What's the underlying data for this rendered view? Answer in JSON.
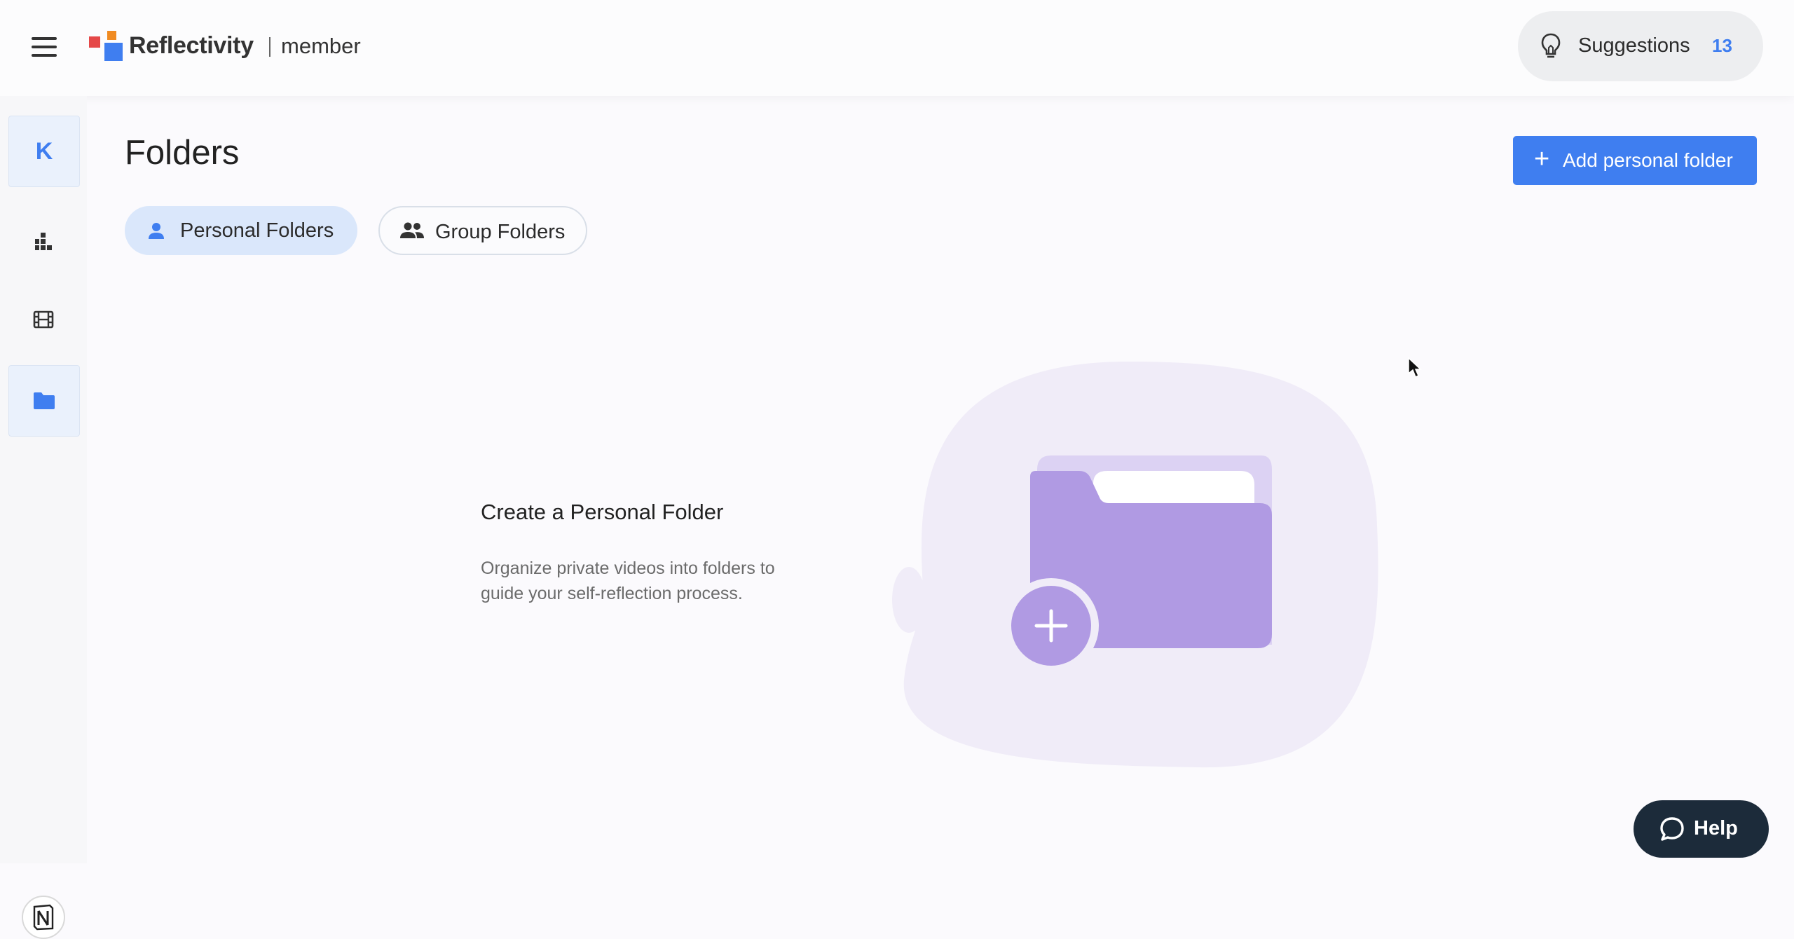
{
  "header": {
    "brand_name": "Reflectivity",
    "brand_role": "member",
    "menu_icon": "hamburger-menu-icon",
    "suggestions": {
      "label": "Suggestions",
      "count": "13",
      "icon": "lightbulb-icon"
    }
  },
  "sidebar": {
    "avatar_initial": "K",
    "items": [
      {
        "icon": "dashboard-chart-icon",
        "active": false
      },
      {
        "icon": "film-icon",
        "active": false
      },
      {
        "icon": "folder-icon",
        "active": true
      }
    ],
    "footer_icon": "notion-logo-icon"
  },
  "main": {
    "title": "Folders",
    "add_button_label": "Add personal folder",
    "tabs": [
      {
        "label": "Personal Folders",
        "icon": "person-icon",
        "active": true
      },
      {
        "label": "Group Folders",
        "icon": "people-icon",
        "active": false
      }
    ],
    "empty_state": {
      "title": "Create a Personal Folder",
      "description": "Organize private videos into folders to guide your self-reflection process."
    }
  },
  "help": {
    "label": "Help",
    "icon": "chat-bubble-icon"
  },
  "colors": {
    "accent": "#3f7ef0",
    "illustration_purple": "#b09ae3",
    "blob_background": "#f0ecf8",
    "help_background": "#1c2b3a"
  }
}
